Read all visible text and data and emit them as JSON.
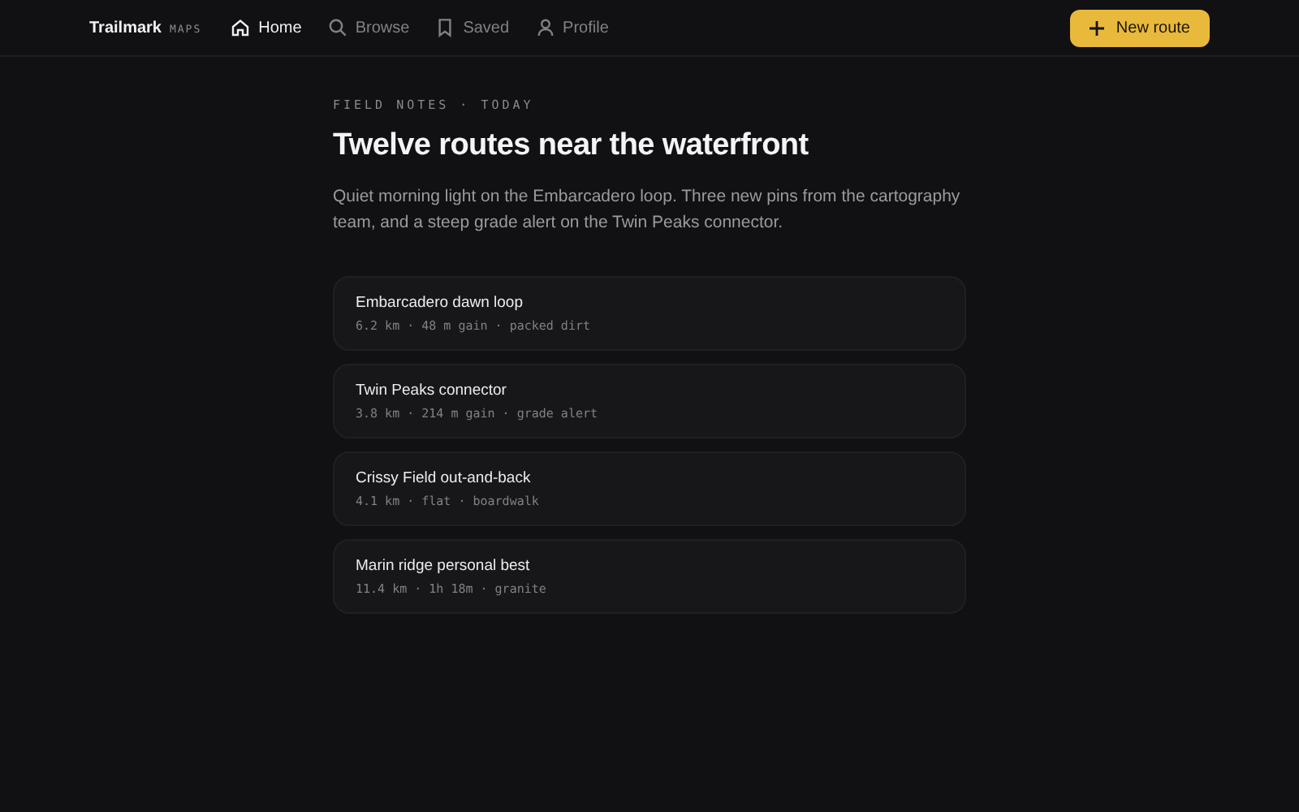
{
  "brand": {
    "name": "Trailmark",
    "tag": "MAPS"
  },
  "nav": [
    {
      "label": "Home",
      "selected": true
    },
    {
      "label": "Browse",
      "selected": false
    },
    {
      "label": "Saved",
      "selected": false
    },
    {
      "label": "Profile",
      "selected": false
    }
  ],
  "action_button": {
    "label": "New route"
  },
  "eyebrow": "FIELD NOTES · TODAY",
  "title": "Twelve routes near the waterfront",
  "intro": "Quiet morning light on the Embarcadero loop. Three new pins from the cartography team, and a steep grade alert on the Twin Peaks connector.",
  "routes": [
    {
      "name": "Embarcadero dawn loop",
      "meta": "6.2 km · 48 m gain · packed dirt"
    },
    {
      "name": "Twin Peaks connector",
      "meta": "3.8 km · 214 m gain · grade alert"
    },
    {
      "name": "Crissy Field out-and-back",
      "meta": "4.1 km · flat · boardwalk"
    },
    {
      "name": "Marin ridge personal best",
      "meta": "11.4 km · 1h 18m · granite"
    }
  ]
}
